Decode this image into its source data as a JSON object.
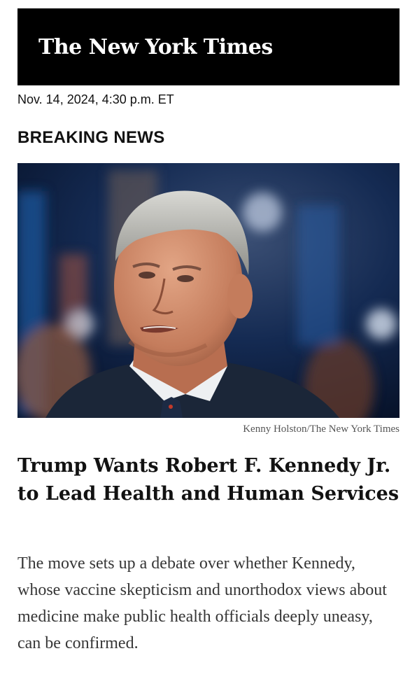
{
  "masthead": {
    "logo_text": "The New York Times"
  },
  "article": {
    "timestamp": "Nov. 14, 2024, 4:30 p.m. ET",
    "kicker": "BREAKING NEWS",
    "photo_credit": "Kenny Holston/The New York Times",
    "headline": "Trump Wants Robert F. Kennedy Jr. to Lead Health and Human Services",
    "summary": "The move sets up a debate over whether Kennedy, whose vaccine skepticism and unorthodox views about medicine make public health officials deeply uneasy, can be confirmed."
  }
}
